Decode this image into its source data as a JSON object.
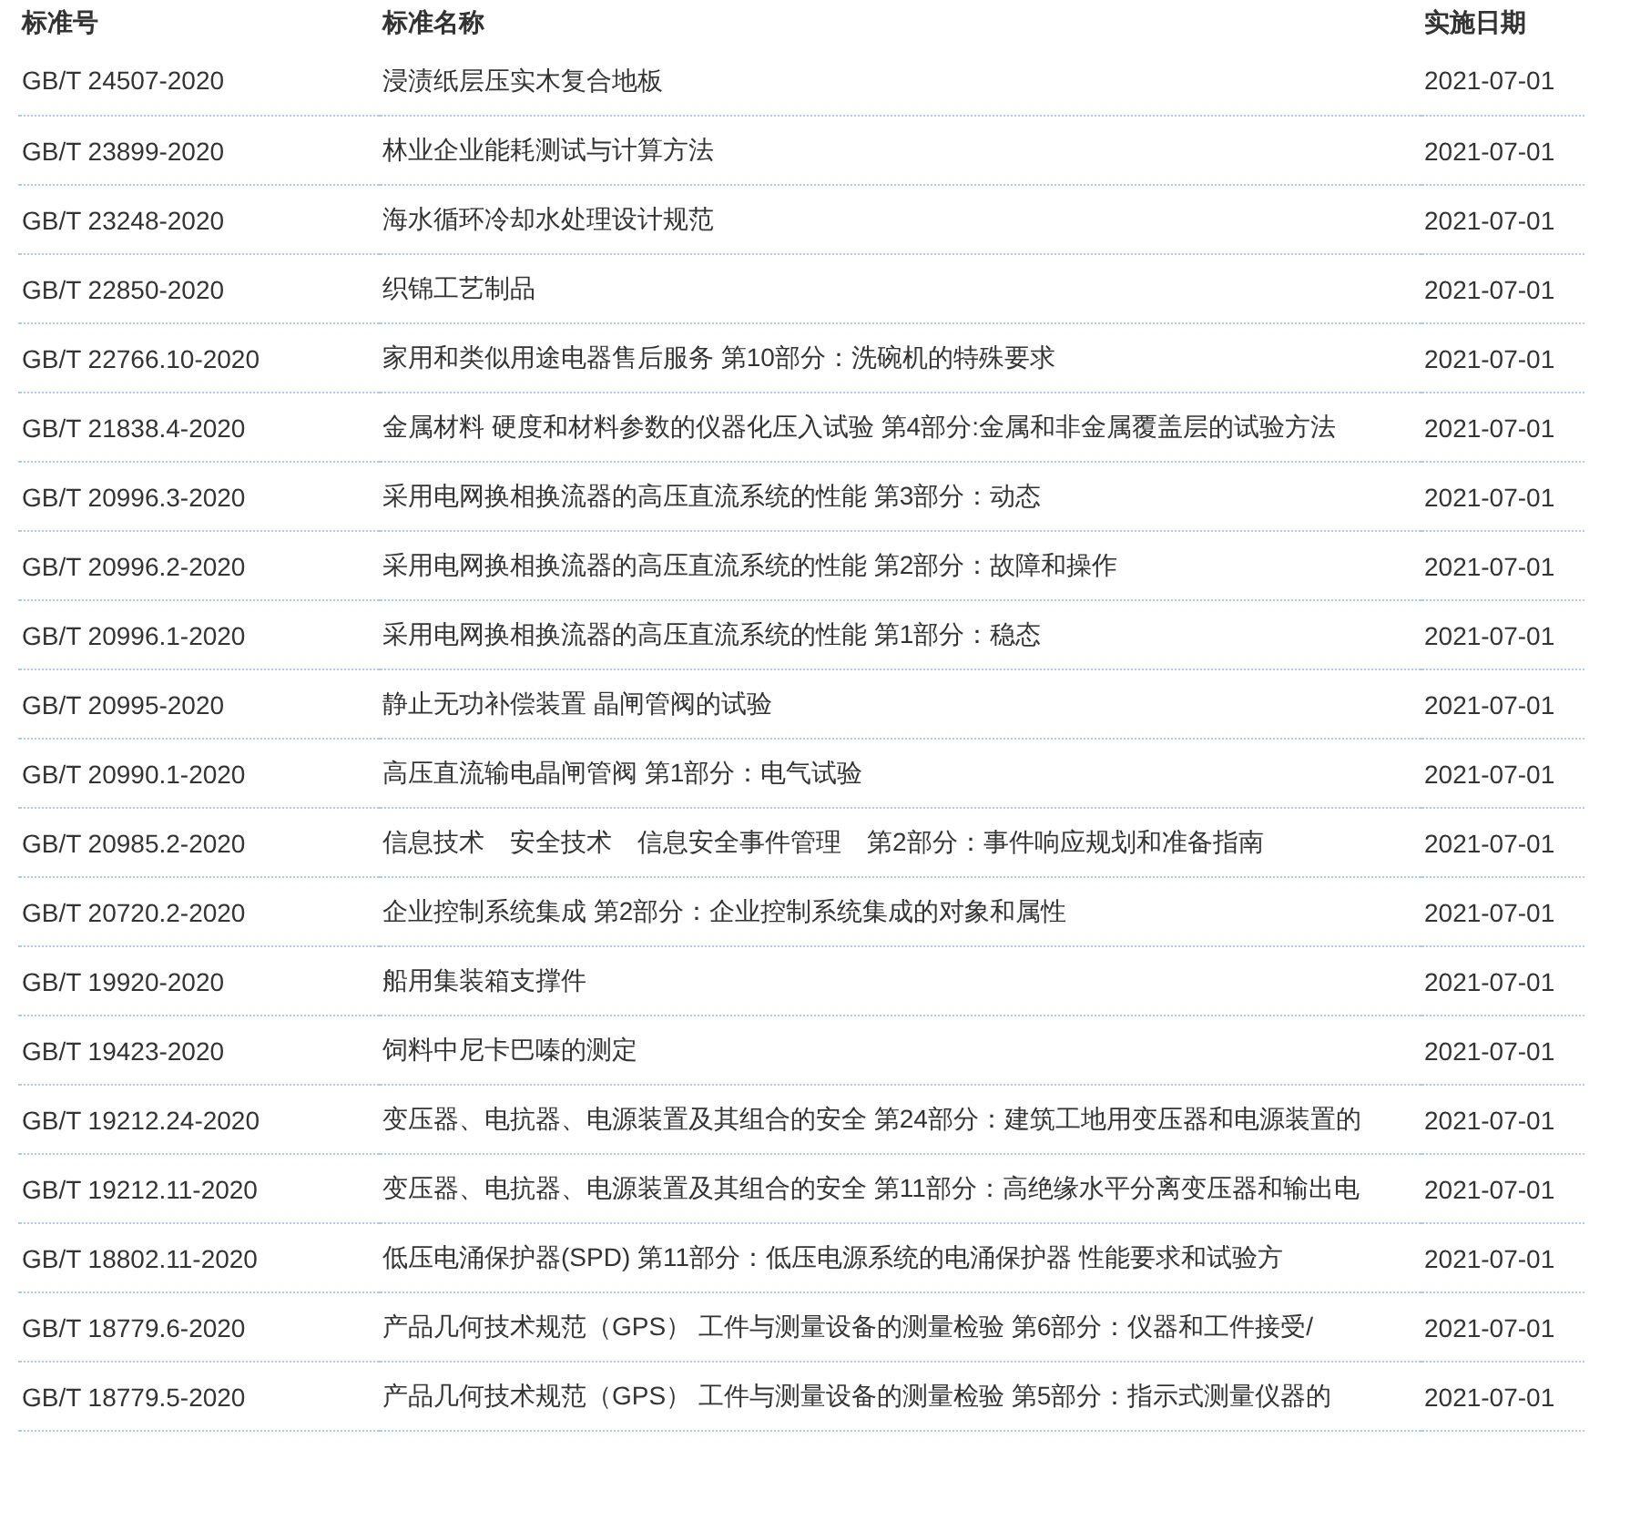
{
  "table": {
    "columns": [
      "标准号",
      "标准名称",
      "实施日期"
    ],
    "rows": [
      [
        "GB/T 24507-2020",
        "浸渍纸层压实木复合地板",
        "2021-07-01"
      ],
      [
        "GB/T 23899-2020",
        "林业企业能耗测试与计算方法",
        "2021-07-01"
      ],
      [
        "GB/T 23248-2020",
        "海水循环冷却水处理设计规范",
        "2021-07-01"
      ],
      [
        "GB/T 22850-2020",
        "织锦工艺制品",
        "2021-07-01"
      ],
      [
        "GB/T 22766.10-2020",
        "家用和类似用途电器售后服务 第10部分：洗碗机的特殊要求",
        "2021-07-01"
      ],
      [
        "GB/T 21838.4-2020",
        "金属材料 硬度和材料参数的仪器化压入试验 第4部分:金属和非金属覆盖层的试验方法",
        "2021-07-01"
      ],
      [
        "GB/T 20996.3-2020",
        "采用电网换相换流器的高压直流系统的性能 第3部分：动态",
        "2021-07-01"
      ],
      [
        "GB/T 20996.2-2020",
        "采用电网换相换流器的高压直流系统的性能 第2部分：故障和操作",
        "2021-07-01"
      ],
      [
        "GB/T 20996.1-2020",
        "采用电网换相换流器的高压直流系统的性能 第1部分：稳态",
        "2021-07-01"
      ],
      [
        "GB/T 20995-2020",
        "静止无功补偿装置 晶闸管阀的试验",
        "2021-07-01"
      ],
      [
        "GB/T 20990.1-2020",
        "高压直流输电晶闸管阀 第1部分：电气试验",
        "2021-07-01"
      ],
      [
        "GB/T 20985.2-2020",
        "信息技术　安全技术　信息安全事件管理　第2部分：事件响应规划和准备指南",
        "2021-07-01"
      ],
      [
        "GB/T 20720.2-2020",
        "企业控制系统集成 第2部分：企业控制系统集成的对象和属性",
        "2021-07-01"
      ],
      [
        "GB/T 19920-2020",
        "船用集装箱支撑件",
        "2021-07-01"
      ],
      [
        "GB/T 19423-2020",
        "饲料中尼卡巴嗪的测定",
        "2021-07-01"
      ],
      [
        "GB/T 19212.24-2020",
        "变压器、电抗器、电源装置及其组合的安全 第24部分：建筑工地用变压器和电源装置的",
        "2021-07-01"
      ],
      [
        "GB/T 19212.11-2020",
        "变压器、电抗器、电源装置及其组合的安全 第11部分：高绝缘水平分离变压器和输出电",
        "2021-07-01"
      ],
      [
        "GB/T 18802.11-2020",
        "低压电涌保护器(SPD) 第11部分：低压电源系统的电涌保护器 性能要求和试验方",
        "2021-07-01"
      ],
      [
        "GB/T 18779.6-2020",
        "产品几何技术规范（GPS） 工件与测量设备的测量检验 第6部分：仪器和工件接受/",
        "2021-07-01"
      ],
      [
        "GB/T 18779.5-2020",
        "产品几何技术规范（GPS） 工件与测量设备的测量检验 第5部分：指示式测量仪器的",
        "2021-07-01"
      ]
    ]
  }
}
